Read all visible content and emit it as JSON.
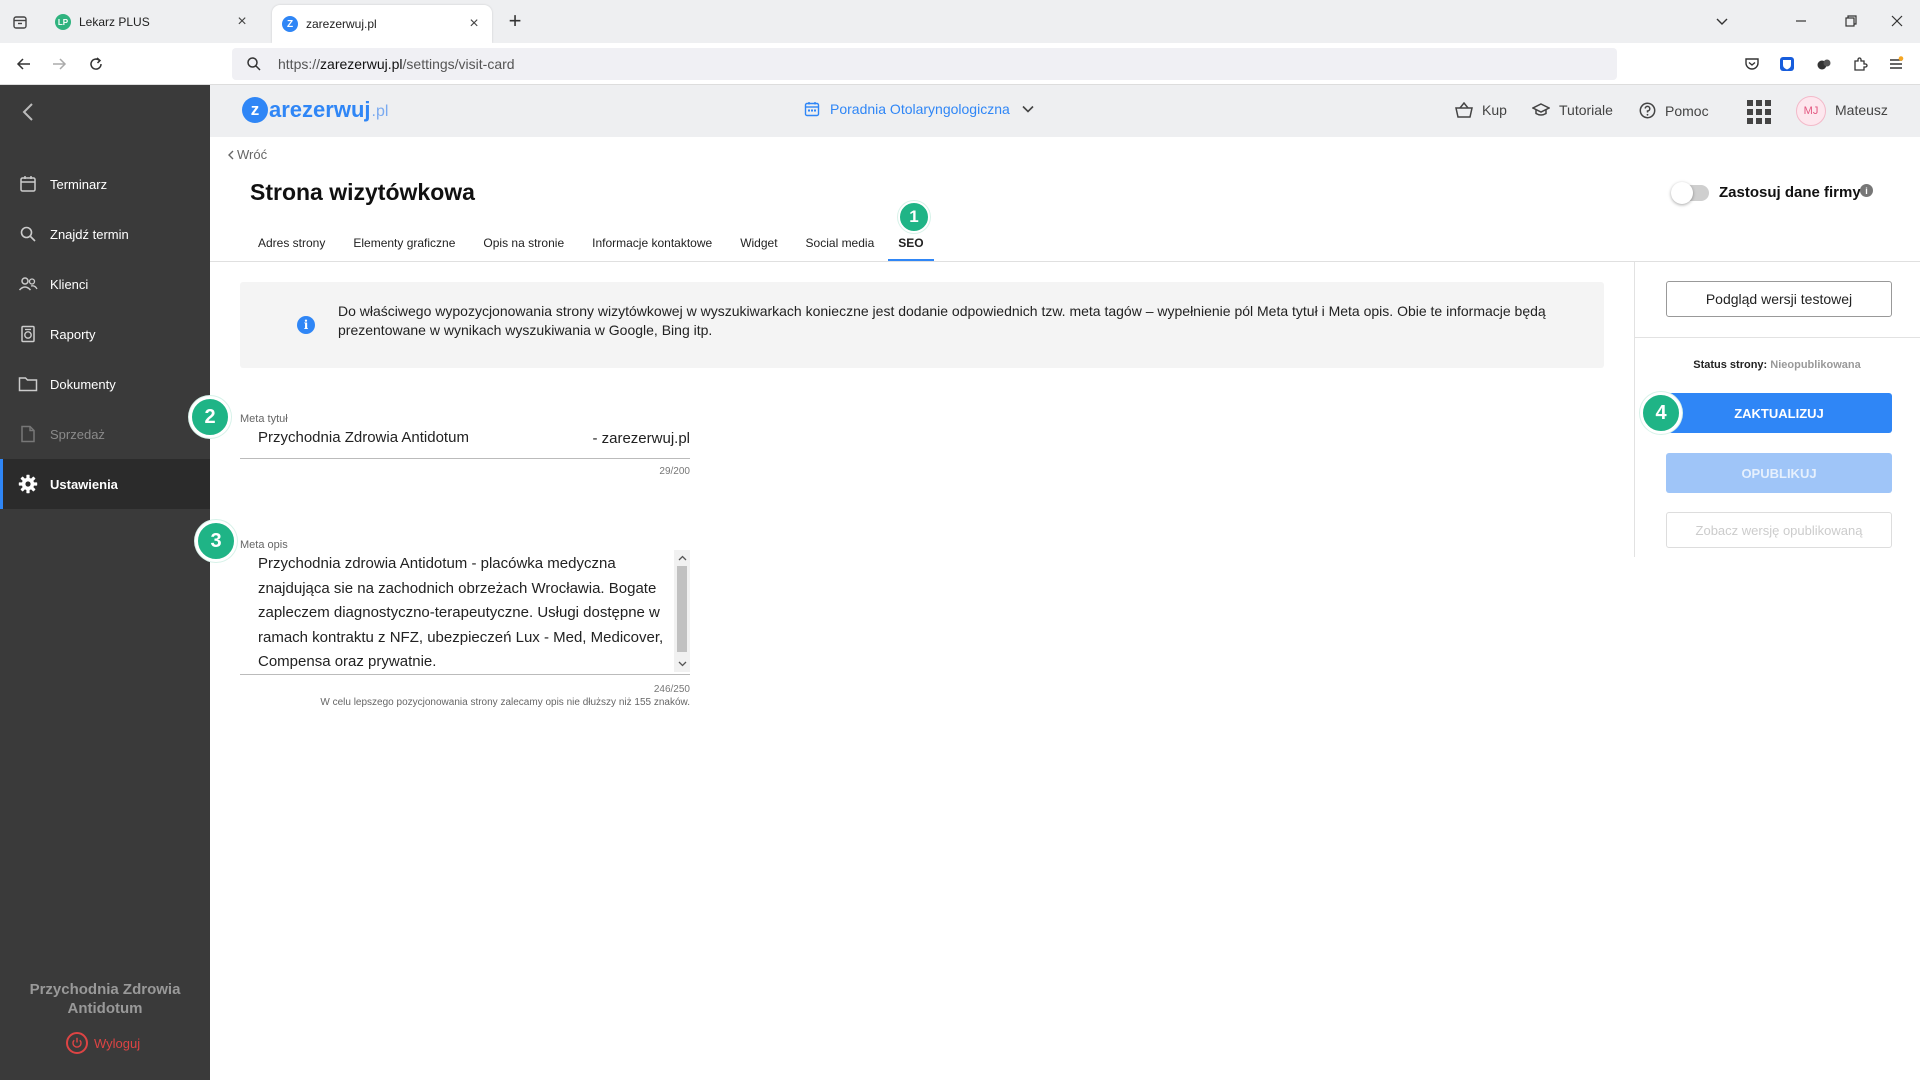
{
  "browser": {
    "tabs": [
      {
        "title": "Lekarz PLUS",
        "favicon": "LP",
        "active": false
      },
      {
        "title": "zarezerwuj.pl",
        "favicon": "Z",
        "active": true
      }
    ],
    "url_prefix": "https://",
    "url_domain": "zarezerwuj.pl",
    "url_path": "/settings/visit-card"
  },
  "sidebar": {
    "items": [
      {
        "label": "Terminarz",
        "icon": "calendar-icon",
        "active": false,
        "dim": false
      },
      {
        "label": "Znajdź termin",
        "icon": "search-icon",
        "active": false,
        "dim": false
      },
      {
        "label": "Klienci",
        "icon": "clients-icon",
        "active": false,
        "dim": false
      },
      {
        "label": "Raporty",
        "icon": "reports-icon",
        "active": false,
        "dim": false
      },
      {
        "label": "Dokumenty",
        "icon": "folder-icon",
        "active": false,
        "dim": false
      },
      {
        "label": "Sprzedaż",
        "icon": "sales-icon",
        "active": false,
        "dim": true
      },
      {
        "label": "Ustawienia",
        "icon": "gear-icon",
        "active": true,
        "dim": false
      }
    ],
    "clinic_name": "Przychodnia Zdrowia Antidotum",
    "logout": "Wyloguj"
  },
  "header": {
    "logo_main": "arezerwuj",
    "logo_letter": "z",
    "logo_domain": ".pl",
    "clinic": "Poradnia Otolaryngologiczna",
    "links": {
      "buy": "Kup",
      "tutorials": "Tutoriale",
      "help": "Pomoc"
    },
    "avatar": "MJ",
    "user": "Mateusz"
  },
  "page": {
    "back": "Wróć",
    "title": "Strona wizytówkowa",
    "toggle_label": "Zastosuj dane firmy",
    "info_icon": "i",
    "tabs": [
      "Adres strony",
      "Elementy graficzne",
      "Opis na stronie",
      "Informacje kontaktowe",
      "Widget",
      "Social media",
      "SEO"
    ],
    "selected_tab": "SEO",
    "info_text": "Do właściwego wypozycjonowania strony wizytówkowej w wyszukiwarkach konieczne jest dodanie odpowiednich tzw. meta tagów – wypełnienie pól Meta tytuł i Meta opis. Obie te informacje będą prezentowane w wynikach wyszukiwania w Google, Bing itp.",
    "meta_title_label": "Meta tytuł",
    "meta_title_value": "Przychodnia Zdrowia Antidotum",
    "meta_title_suffix": "- zarezerwuj.pl",
    "meta_title_counter": "29/200",
    "meta_desc_label": "Meta opis",
    "meta_desc_value": "Przychodnia zdrowia Antidotum - placówka medyczna znajdująca sie na zachodnich obrzeżach Wrocławia. Bogate zapleczem diagnostyczno-terapeutyczne. Usługi dostępne w ramach kontraktu z NFZ, ubezpieczeń Lux - Med, Medicover, Compensa oraz prywatnie.",
    "meta_desc_counter": "246/250",
    "meta_desc_hint": "W celu lepszego pozycjonowania strony zalecamy opis nie dłuższy niż 155 znaków."
  },
  "badges": [
    "1",
    "2",
    "3",
    "4"
  ],
  "panel": {
    "preview": "Podgląd wersji testowej",
    "status_label": "Status strony:",
    "status_value": "Nieopublikowana",
    "update": "ZAKTUALIZUJ",
    "publish": "OPUBLIKUJ",
    "view_published": "Zobacz wersję opublikowaną"
  },
  "colors": {
    "accent": "#2f86f6",
    "badge": "#1fb486",
    "sidebar": "#3a3a3a",
    "logout": "#dd4444"
  }
}
